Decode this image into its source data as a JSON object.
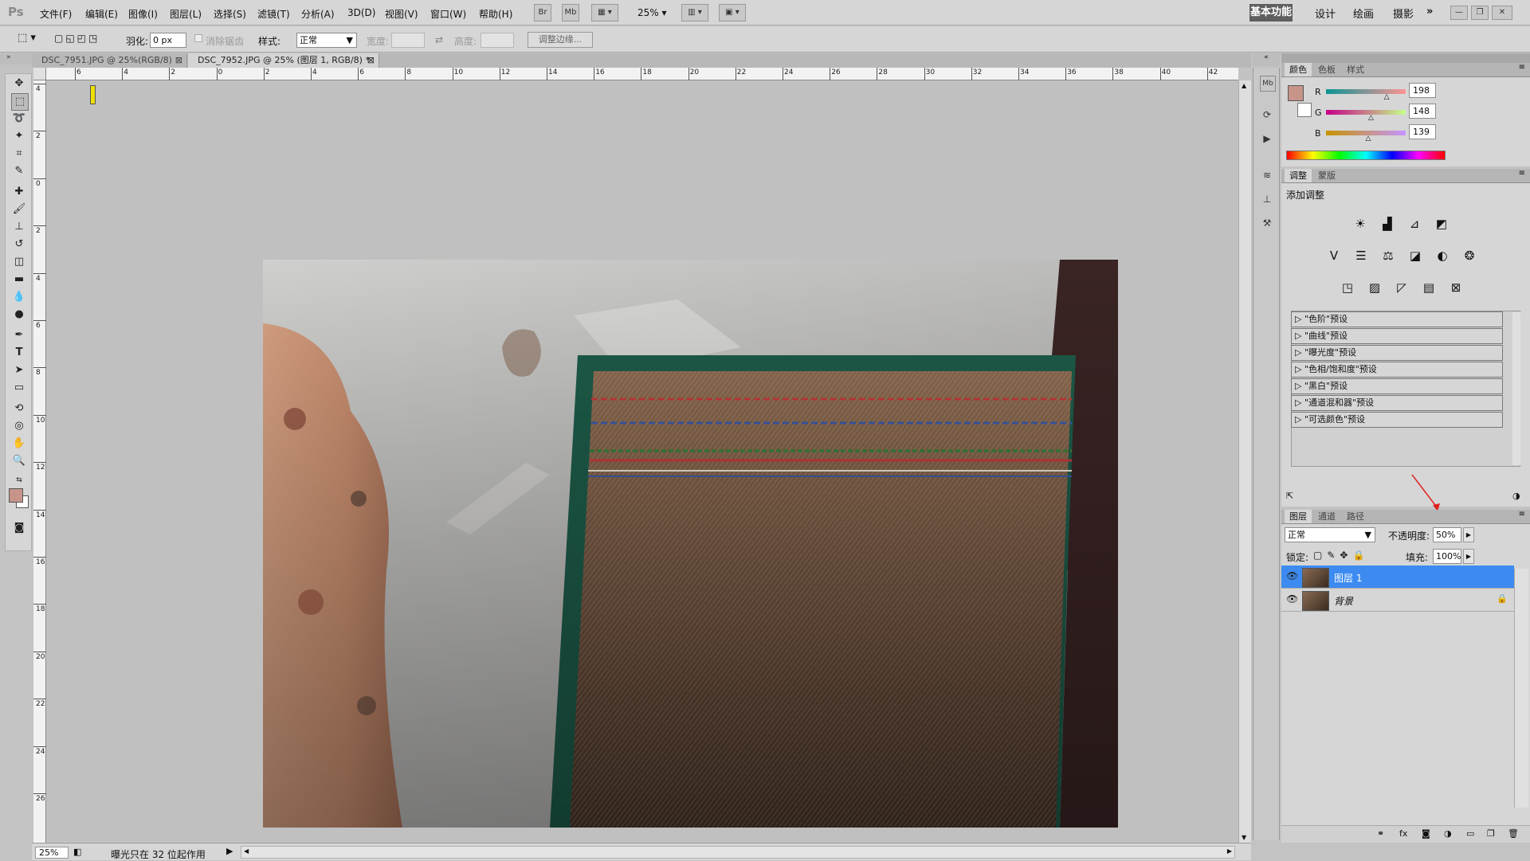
{
  "app": {
    "logo": "Ps"
  },
  "menu": [
    "文件(F)",
    "编辑(E)",
    "图像(I)",
    "图层(L)",
    "选择(S)",
    "滤镜(T)",
    "分析(A)",
    "3D(D)",
    "视图(V)",
    "窗口(W)",
    "帮助(H)"
  ],
  "menubar": {
    "bridge_label": "Br",
    "mini_bridge_label": "Mb",
    "zoom_label": "25%",
    "workspaces": [
      "基本功能",
      "设计",
      "绘画",
      "摄影"
    ],
    "more_label": "»"
  },
  "options": {
    "feather_label": "羽化:",
    "feather_value": "0 px",
    "antialias_label": "消除锯齿",
    "style_label": "样式:",
    "style_value": "正常",
    "width_label": "宽度:",
    "height_label": "高度:",
    "refine_edge_label": "调整边缘..."
  },
  "tabs": [
    {
      "label": "DSC_7951.JPG @ 25%(RGB/8)"
    },
    {
      "label": "DSC_7952.JPG @ 25% (图层 1, RGB/8) *"
    }
  ],
  "ruler": {
    "h": [
      "6",
      "4",
      "2",
      "0",
      "2",
      "4",
      "6",
      "8",
      "10",
      "12",
      "14",
      "16",
      "18",
      "20",
      "22",
      "24",
      "26",
      "28",
      "30",
      "32",
      "34",
      "36",
      "38",
      "40",
      "42"
    ],
    "v": [
      "4",
      "2",
      "0",
      "2",
      "4",
      "6",
      "8",
      "10",
      "12",
      "14",
      "16",
      "18",
      "20",
      "22",
      "24",
      "26"
    ]
  },
  "status": {
    "zoom": "25%",
    "message": "曝光只在 32 位起作用"
  },
  "color_panel": {
    "tabs": [
      "颜色",
      "色板",
      "样式"
    ],
    "foreground": "#c69489",
    "channels": [
      {
        "label": "R",
        "value": "198",
        "level": 0.776
      },
      {
        "label": "G",
        "value": "148",
        "level": 0.58
      },
      {
        "label": "B",
        "value": "139",
        "level": 0.545
      }
    ]
  },
  "adjust_panel": {
    "tabs": [
      "调整",
      "蒙版"
    ],
    "title": "添加调整",
    "presets": [
      "\"色阶\"预设",
      "\"曲线\"预设",
      "\"曝光度\"预设",
      "\"色相/饱和度\"预设",
      "\"黑白\"预设",
      "\"通道混和器\"预设",
      "\"可选颜色\"预设"
    ]
  },
  "layers_panel": {
    "tabs": [
      "图层",
      "通道",
      "路径"
    ],
    "blend_mode": "正常",
    "opacity_label": "不透明度:",
    "opacity_value": "50%",
    "lock_label": "锁定:",
    "fill_label": "填充:",
    "fill_value": "100%",
    "layers": [
      {
        "name": "图层 1",
        "selected": true
      },
      {
        "name": "背景",
        "selected": false,
        "locked": true
      }
    ]
  }
}
